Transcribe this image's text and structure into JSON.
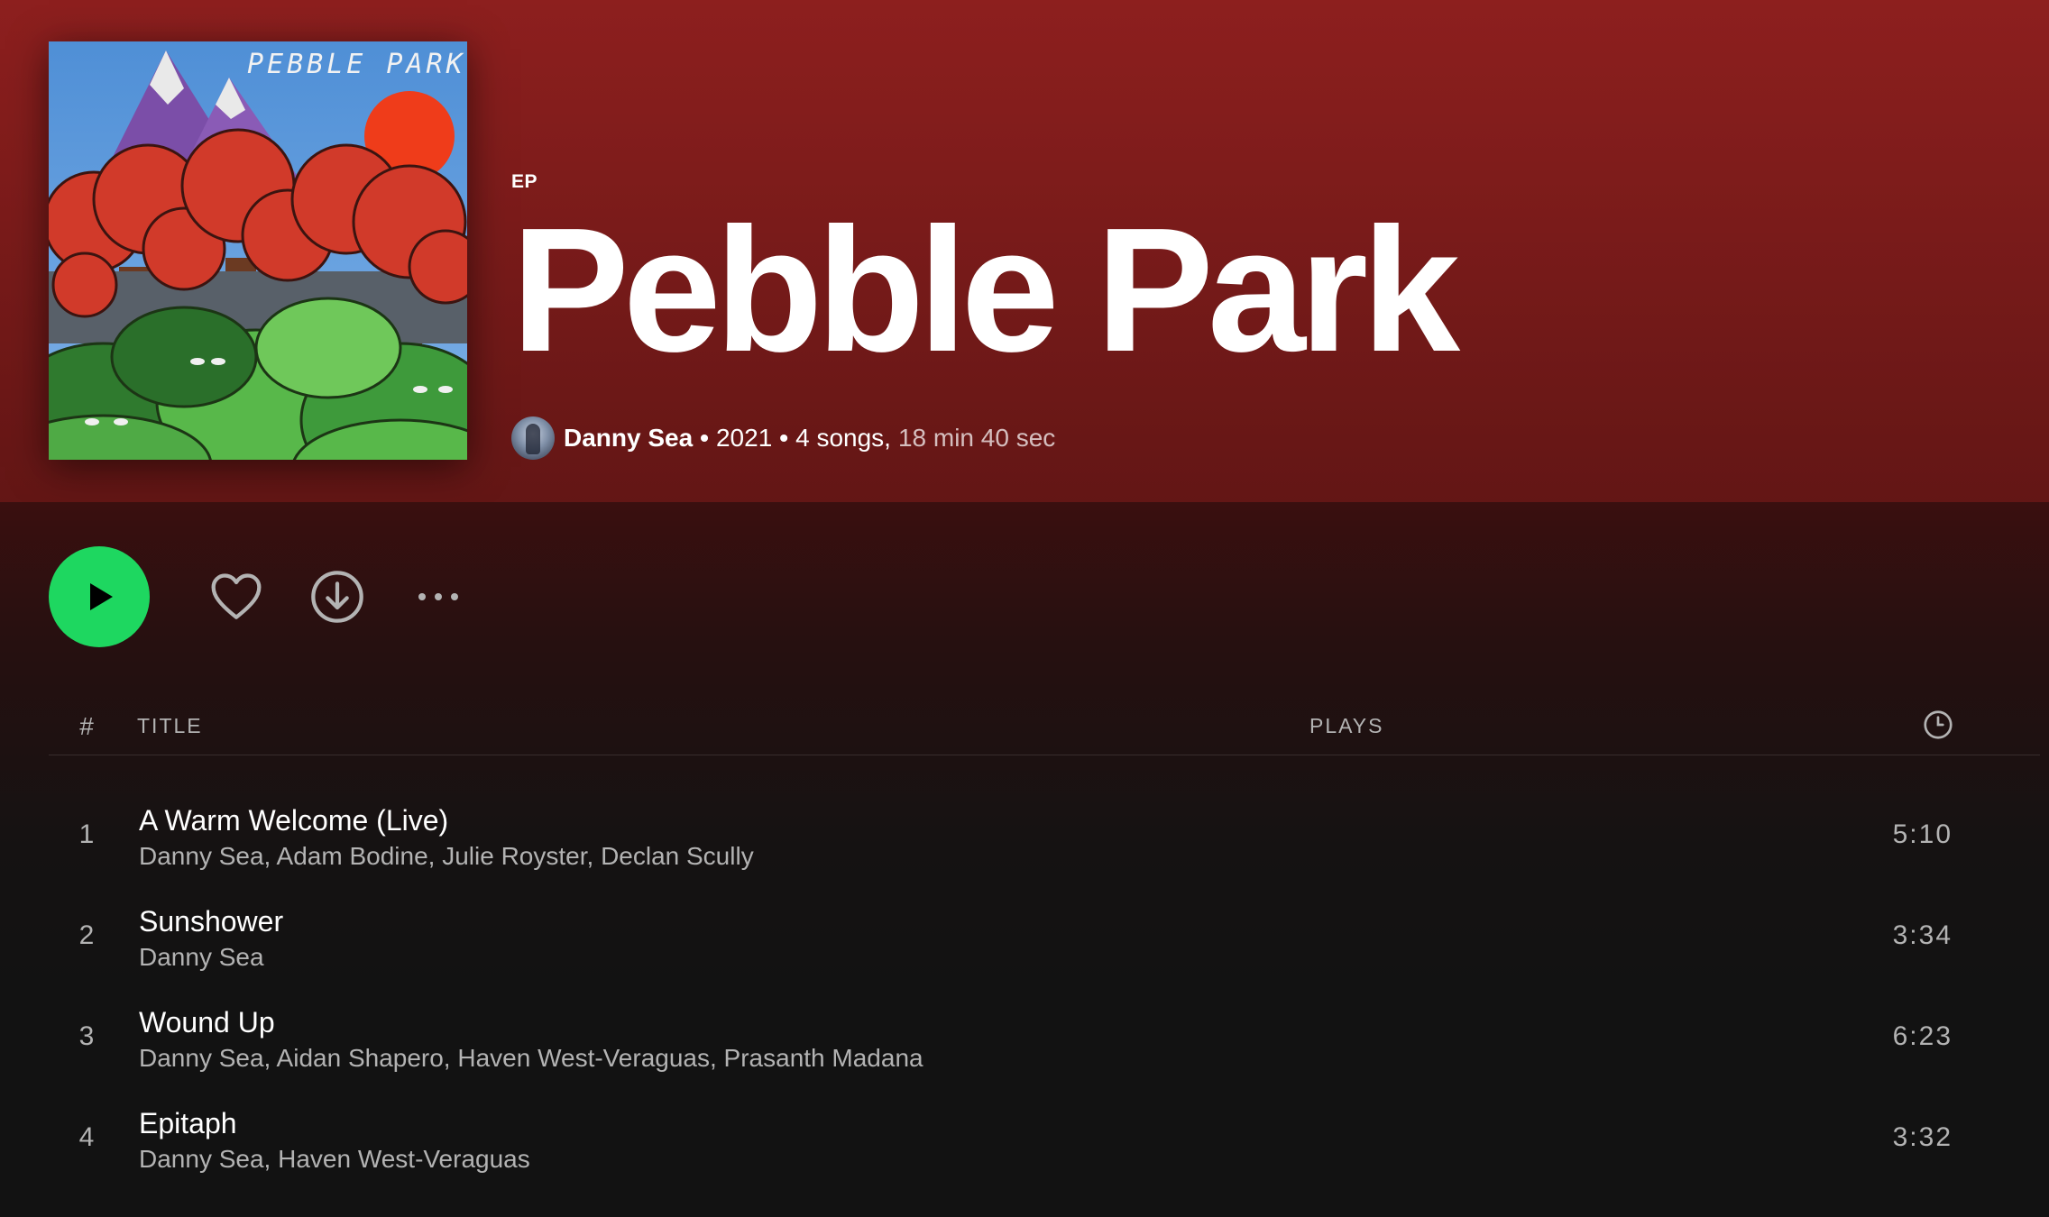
{
  "header": {
    "type_label": "EP",
    "title": "Pebble Park",
    "cover_text": "PEBBLE PARK",
    "artist": "Danny Sea",
    "separator": "•",
    "year": "2021",
    "song_count": "4 songs,",
    "duration": "18 min 40 sec"
  },
  "actions": {
    "play_icon": "play-icon",
    "like_icon": "heart-icon",
    "download_icon": "download-icon",
    "more_icon": "more-horizontal-icon"
  },
  "tracklist": {
    "headers": {
      "number": "#",
      "title": "TITLE",
      "plays": "PLAYS",
      "duration_icon": "clock-icon"
    },
    "tracks": [
      {
        "number": "1",
        "title": "A Warm Welcome (Live)",
        "artists": "Danny Sea, Adam Bodine, Julie Royster, Declan Scully",
        "duration": "5:10"
      },
      {
        "number": "2",
        "title": "Sunshower",
        "artists": "Danny Sea",
        "duration": "3:34"
      },
      {
        "number": "3",
        "title": "Wound Up",
        "artists": "Danny Sea, Aidan Shapero, Haven West-Veraguas, Prasanth Madana",
        "duration": "6:23"
      },
      {
        "number": "4",
        "title": "Epitaph",
        "artists": "Danny Sea, Haven West-Veraguas",
        "duration": "3:32"
      }
    ]
  },
  "colors": {
    "header_red": "#8d1f1e",
    "play_green": "#1ed760",
    "background": "#121212",
    "muted_text": "#b3b3b3"
  }
}
